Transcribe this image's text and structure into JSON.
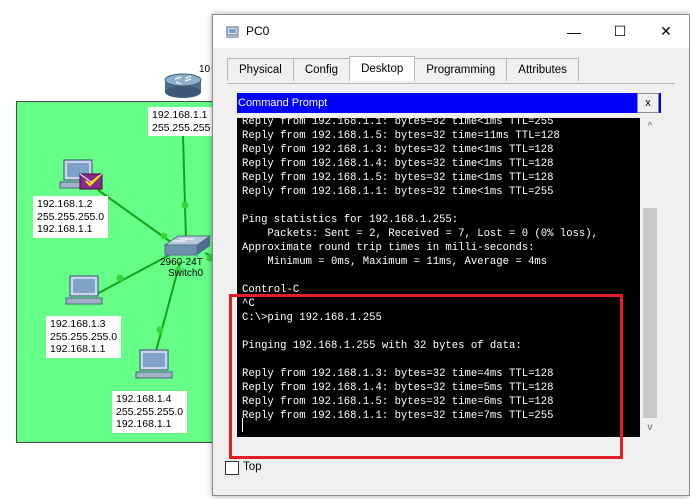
{
  "topology": {
    "router": {
      "label_top": "10",
      "ip": "192.168.1.1",
      "mask": "255.255.255"
    },
    "switch": {
      "label_model": "2960-24T",
      "label_name": "Switch0"
    },
    "pcs": [
      {
        "ip": "192.168.1.2",
        "mask": "255.255.255.0",
        "gw": "192.168.1.1"
      },
      {
        "ip": "192.168.1.3",
        "mask": "255.255.255.0",
        "gw": "192.168.1.1"
      },
      {
        "ip": "192.168.1.4",
        "mask": "255.255.255.0",
        "gw": "192.168.1.1"
      }
    ],
    "colors": {
      "background": "#66ff88",
      "link": "#18a018",
      "link_dot": "#3bd33b"
    }
  },
  "window": {
    "title": "PC0",
    "tabs": [
      "Physical",
      "Config",
      "Desktop",
      "Programming",
      "Attributes"
    ],
    "active_tab": "Desktop",
    "controls": {
      "minimize": "—",
      "maximize": "☐",
      "close": "✕"
    }
  },
  "command_prompt": {
    "title": "Command Prompt",
    "close_label": "x",
    "lines": [
      "Reply from 192.168.1.1: bytes=32 time<1ms TTL=255",
      "Reply from 192.168.1.5: bytes=32 time=11ms TTL=128",
      "Reply from 192.168.1.3: bytes=32 time<1ms TTL=128",
      "Reply from 192.168.1.4: bytes=32 time<1ms TTL=128",
      "Reply from 192.168.1.5: bytes=32 time<1ms TTL=128",
      "Reply from 192.168.1.1: bytes=32 time<1ms TTL=255",
      "",
      "Ping statistics for 192.168.1.255:",
      "    Packets: Sent = 2, Received = 7, Lost = 0 (0% loss),",
      "Approximate round trip times in milli-seconds:",
      "    Minimum = 0ms, Maximum = 11ms, Average = 4ms",
      "",
      "Control-C",
      "^C",
      "C:\\>ping 192.168.1.255",
      "",
      "Pinging 192.168.1.255 with 32 bytes of data:",
      "",
      "Reply from 192.168.1.3: bytes=32 time=4ms TTL=128",
      "Reply from 192.168.1.4: bytes=32 time=5ms TTL=128",
      "Reply from 192.168.1.5: bytes=32 time=6ms TTL=128",
      "Reply from 192.168.1.1: bytes=32 time=7ms TTL=255"
    ],
    "scroll_up": "^",
    "scroll_down": "v"
  },
  "footer": {
    "top_label": "Top",
    "top_checked": false
  },
  "highlight": {
    "color": "#e41e26"
  }
}
